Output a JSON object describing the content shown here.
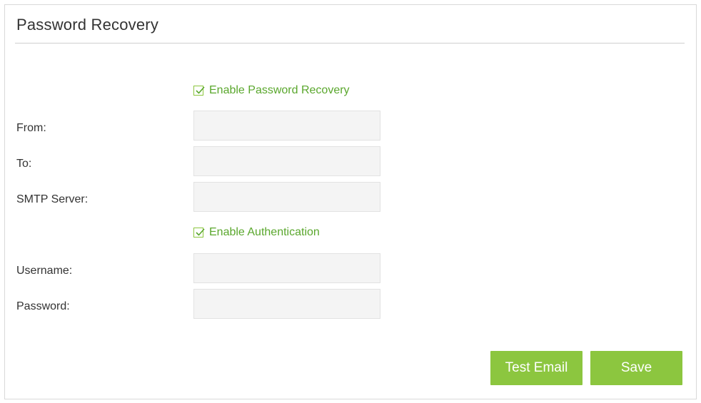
{
  "page": {
    "title": "Password Recovery"
  },
  "options": {
    "enable_password_recovery": {
      "label": "Enable Password Recovery",
      "checked": true
    },
    "enable_authentication": {
      "label": "Enable Authentication",
      "checked": true
    }
  },
  "fields": {
    "from": {
      "label": "From:",
      "value": ""
    },
    "to": {
      "label": "To:",
      "value": ""
    },
    "smtp_server": {
      "label": "SMTP Server:",
      "value": ""
    },
    "username": {
      "label": "Username:",
      "value": ""
    },
    "password": {
      "label": "Password:",
      "value": ""
    }
  },
  "buttons": {
    "test_email": "Test Email",
    "save": "Save"
  },
  "colors": {
    "accent": "#8cc63f",
    "accent_text": "#5aa72d",
    "input_bg": "#f4f4f4"
  }
}
